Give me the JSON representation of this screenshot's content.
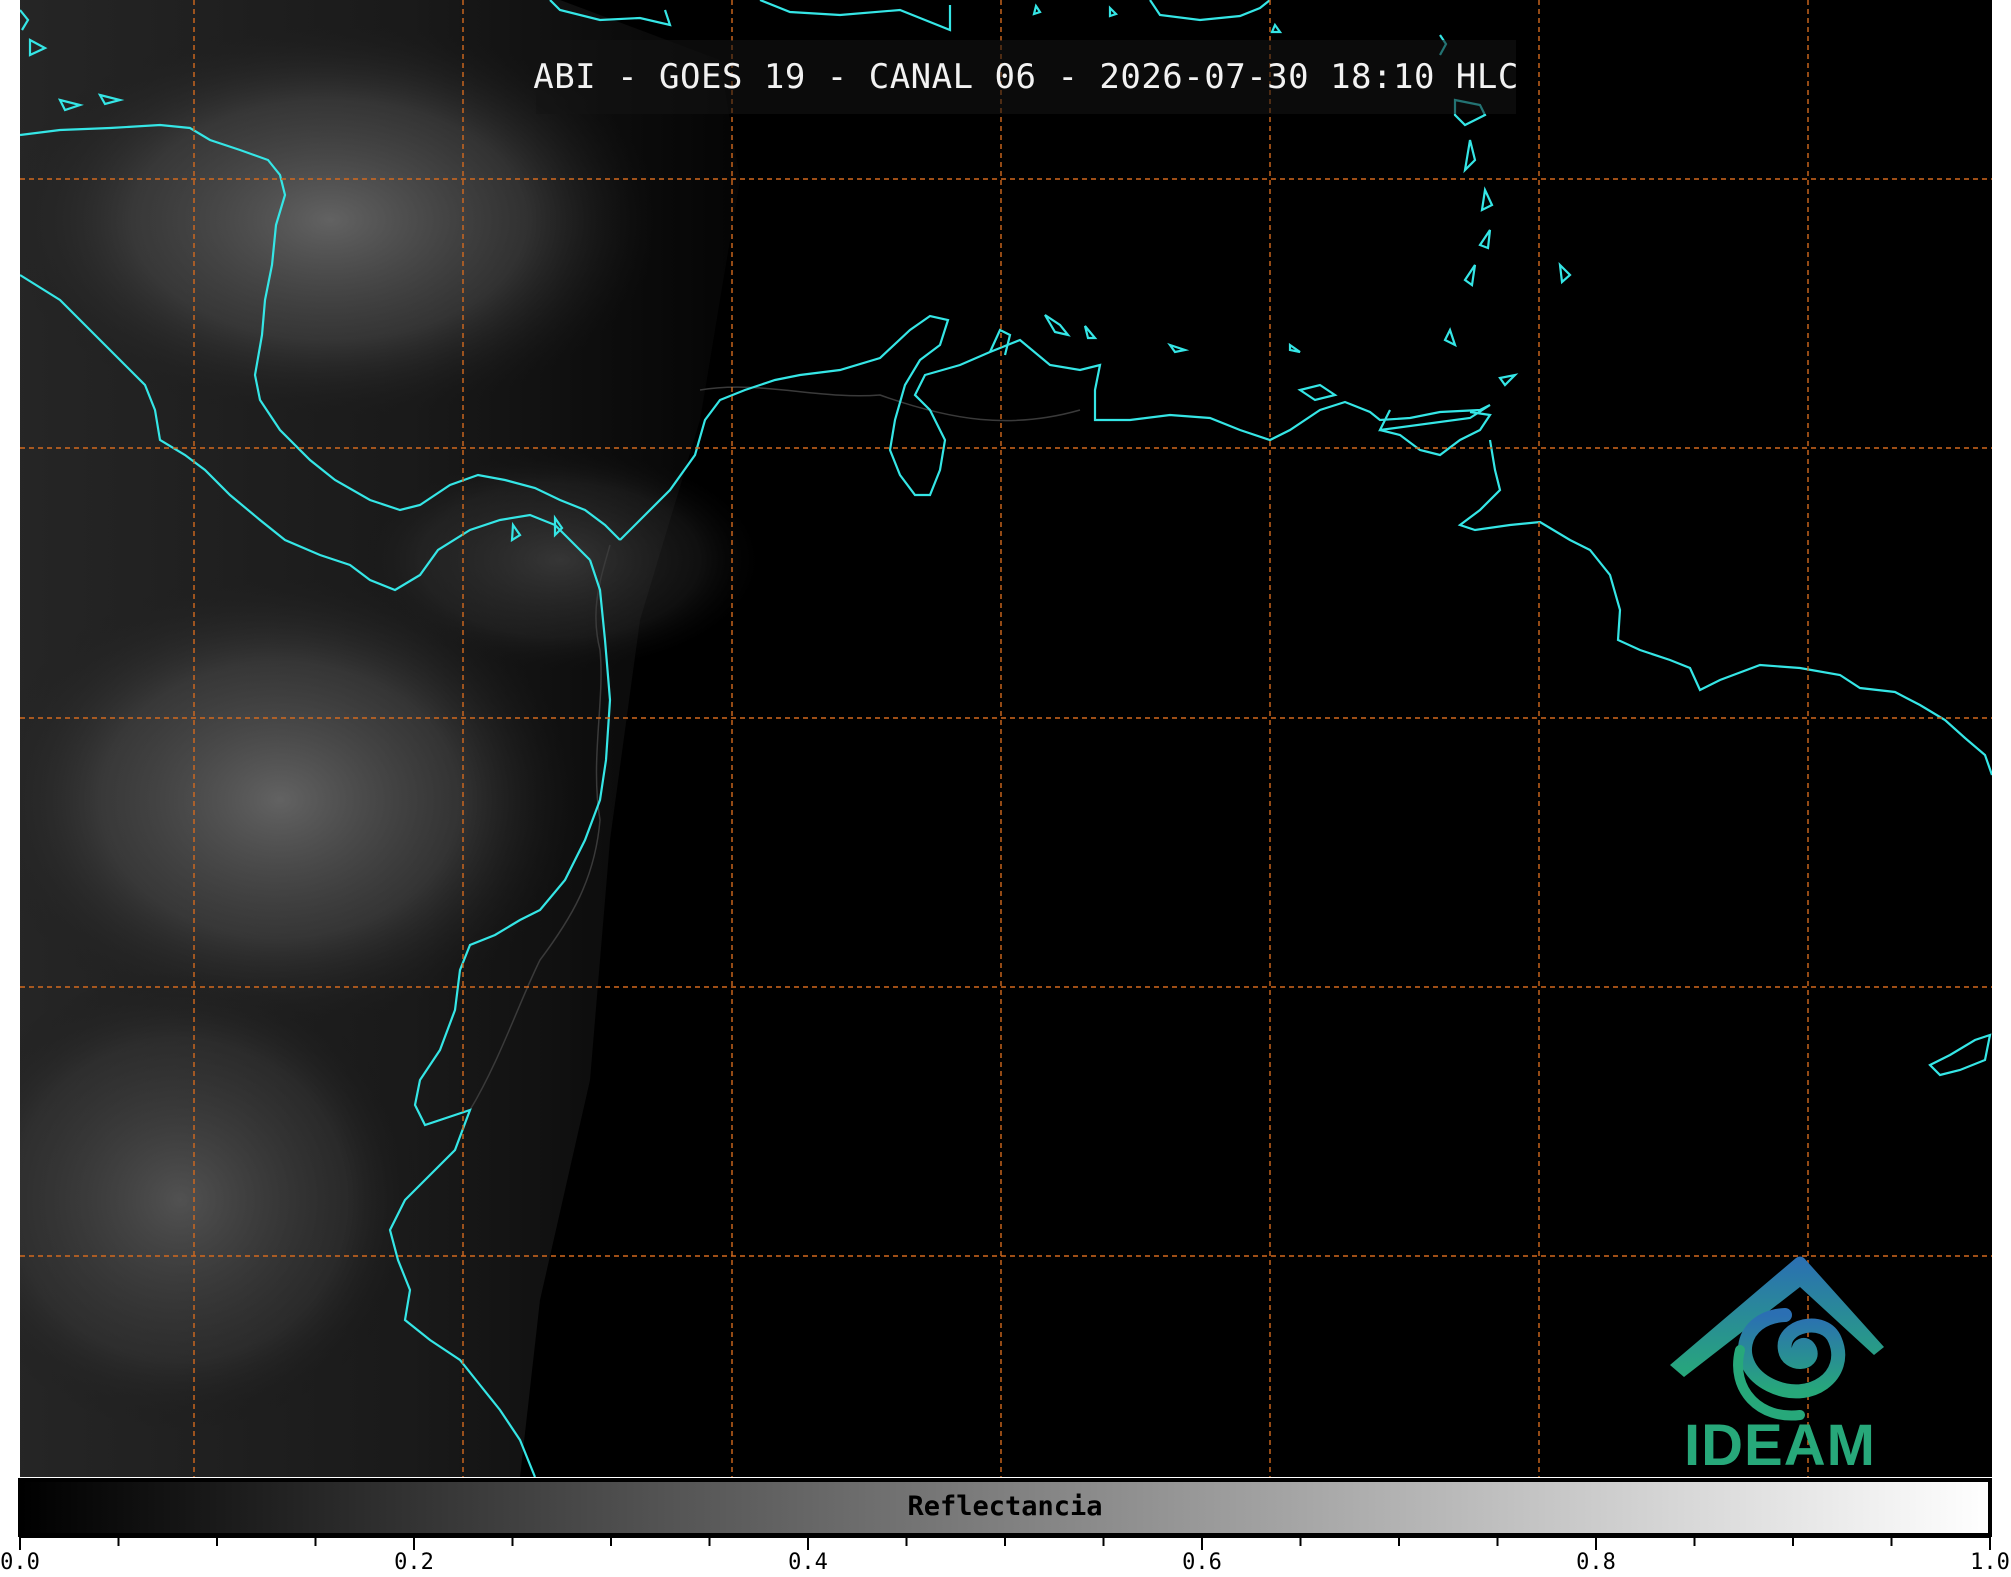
{
  "title": "ABI - GOES 19 - CANAL 06 - 2026-07-30 18:10 HLC",
  "colorbar": {
    "label": "Reflectancia",
    "ticks": [
      "0.0",
      "0.2",
      "0.4",
      "0.6",
      "0.8",
      "1.0"
    ],
    "range": [
      0.0,
      1.0
    ],
    "gradient": [
      "#000000",
      "#ffffff"
    ]
  },
  "map": {
    "background": "#000000",
    "coastline_color": "#35e6e6",
    "border_color": "#3a3a3a",
    "gridline_color": "#d2691e",
    "gridline_style": "dashed"
  },
  "logo": {
    "text": "IDEAM",
    "icon": "ideam-swirl-logo-icon",
    "colors": [
      "#2b6fb3",
      "#27a87a"
    ]
  }
}
